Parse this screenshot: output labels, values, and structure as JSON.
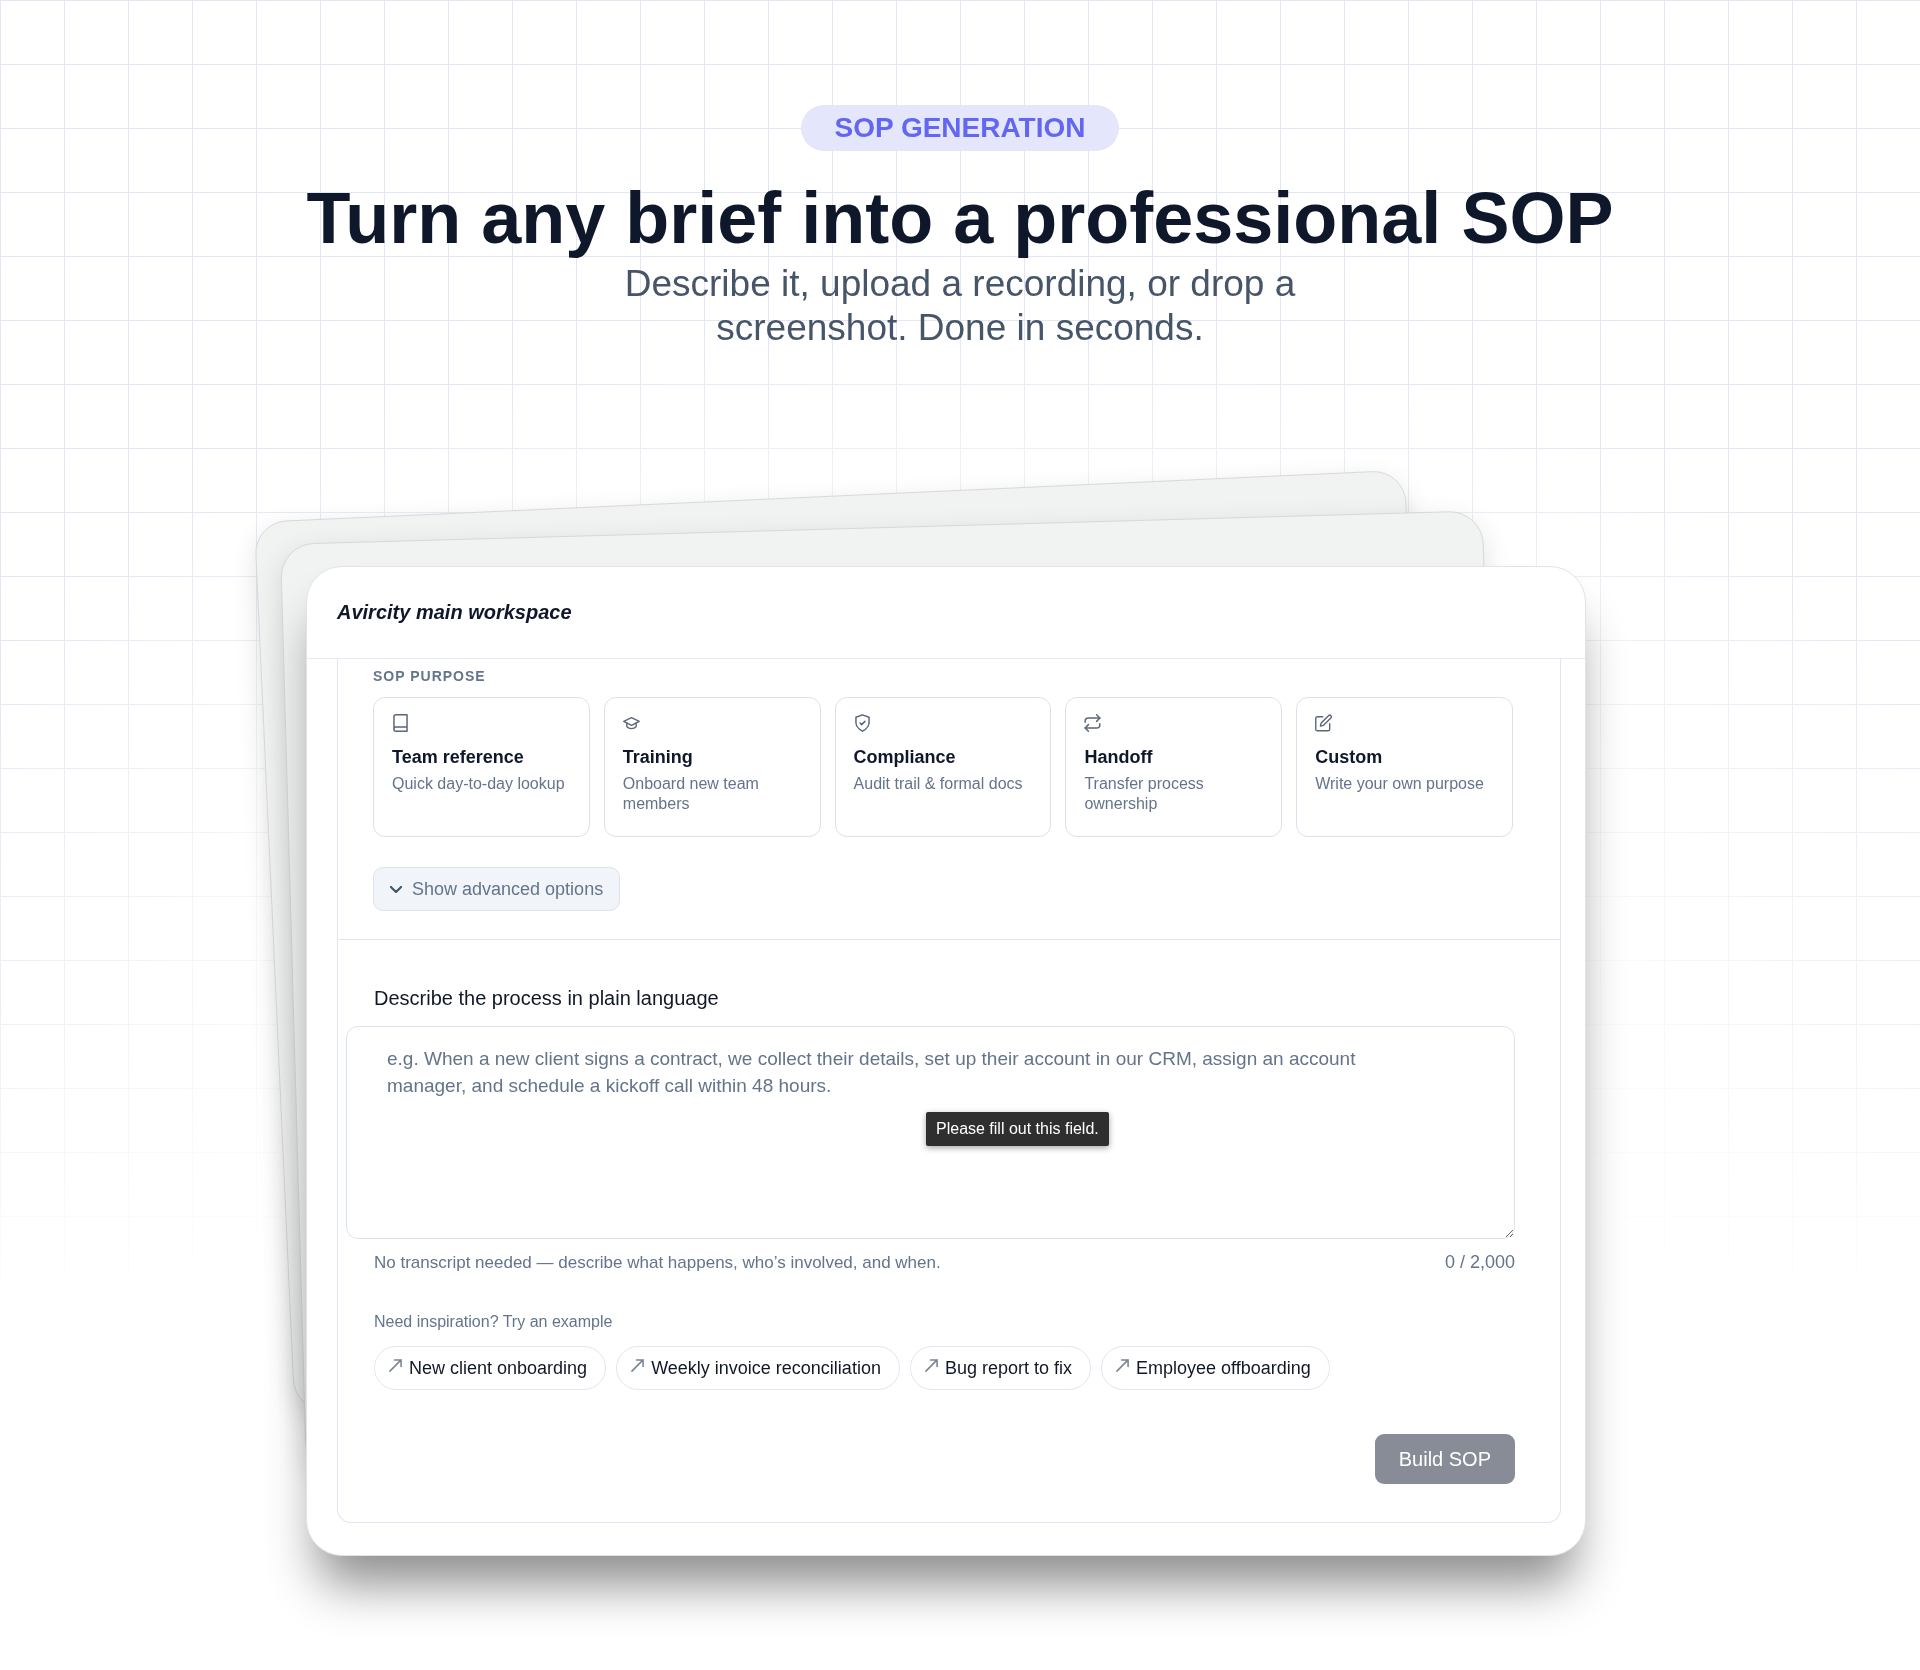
{
  "header": {
    "badge": "SOP GENERATION",
    "title": "Turn any brief into a professional SOP",
    "subtitle": "Describe it, upload a recording, or drop a screenshot. Done in seconds."
  },
  "workspace": {
    "title": "Avircity main workspace",
    "purpose": {
      "label": "SOP PURPOSE",
      "options": [
        {
          "title": "Team reference",
          "description": "Quick day-to-day lookup",
          "selected": false
        },
        {
          "title": "Training",
          "description": "Onboard new team members",
          "selected": false
        },
        {
          "title": "Compliance",
          "description": "Audit trail & formal docs",
          "selected": false
        },
        {
          "title": "Handoff",
          "description": "Transfer process ownership",
          "selected": false
        },
        {
          "title": "Custom",
          "description": "Write your own purpose",
          "selected": false
        }
      ]
    },
    "advanced_toggle": {
      "label": "Show advanced options",
      "expanded": false
    },
    "description": {
      "label": "Describe the process in plain language",
      "placeholder": "e.g. When a new client signs a contract, we collect their details, set up their account in our CRM, assign an account manager, and schedule a kickoff call within 48 hours.",
      "validation_message": "Please fill out this field.",
      "helper": "No transcript needed — describe what happens, who’s involved, and when.",
      "counter": "0 / 2,000"
    },
    "examples": {
      "label": "Need inspiration? Try an example",
      "items": [
        "New client onboarding",
        "Weekly invoice reconciliation",
        "Bug report to fix",
        "Employee offboarding"
      ]
    },
    "submit": {
      "label": "Build SOP",
      "disabled": true
    }
  }
}
